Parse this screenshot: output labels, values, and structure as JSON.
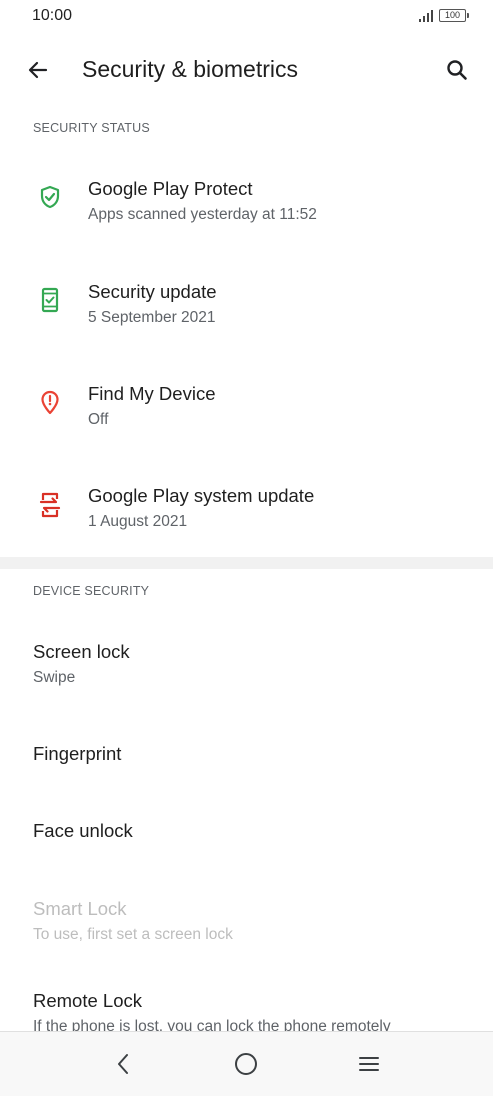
{
  "status_bar": {
    "time": "10:00",
    "battery": "100"
  },
  "app_bar": {
    "title": "Security & biometrics"
  },
  "sections": {
    "security_status": {
      "header": "SECURITY STATUS",
      "items": [
        {
          "title": "Google Play Protect",
          "subtitle": "Apps scanned yesterday at 11:52",
          "icon": "shield-check-icon",
          "color": "#34a853"
        },
        {
          "title": "Security update",
          "subtitle": "5 September 2021",
          "icon": "phone-check-icon",
          "color": "#34a853"
        },
        {
          "title": "Find My Device",
          "subtitle": "Off",
          "icon": "location-alert-icon",
          "color": "#ea4335"
        },
        {
          "title": "Google Play system update",
          "subtitle": "1 August 2021",
          "icon": "system-update-icon",
          "color": "#d93025"
        }
      ]
    },
    "device_security": {
      "header": "DEVICE SECURITY",
      "items": [
        {
          "title": "Screen lock",
          "subtitle": "Swipe"
        },
        {
          "title": "Fingerprint"
        },
        {
          "title": "Face unlock"
        },
        {
          "title": "Smart Lock",
          "subtitle": "To use, first set a screen lock",
          "disabled": true
        },
        {
          "title": "Remote Lock",
          "subtitle": "If the phone is lost, you can lock the phone remotely"
        }
      ]
    }
  }
}
